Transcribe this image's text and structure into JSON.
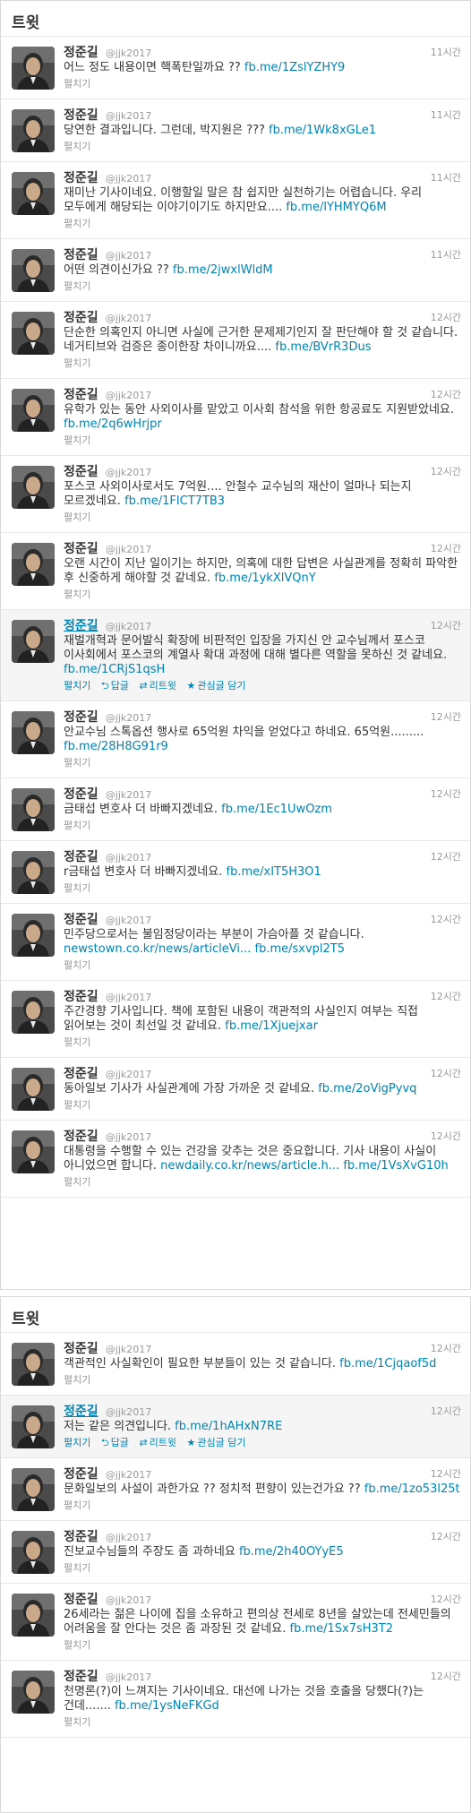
{
  "panels": [
    {
      "title": "트윗",
      "tweets": [
        {
          "name": "정준길",
          "handle": "@jjk2017",
          "time": "11시간",
          "text": "어느 정도 내용이면 핵폭탄일까요 ?? ",
          "link": "fb.me/1ZslYZHY9",
          "expand": "펼치기"
        },
        {
          "name": "정준길",
          "handle": "@jjk2017",
          "time": "11시간",
          "text": "당연한 결과입니다. 그런데, 박지원은 ??? ",
          "link": "fb.me/1Wk8xGLe1",
          "expand": "펼치기"
        },
        {
          "name": "정준길",
          "handle": "@jjk2017",
          "time": "11시간",
          "text": "재미난 기사이네요. 이행할일 말은 참 쉽지만 실천하기는 어렵습니다. 우리 모두에게 해당되는 이야기이기도 하지만요.... ",
          "link": "fb.me/lYHMYQ6M",
          "expand": "펼치기"
        },
        {
          "name": "정준길",
          "handle": "@jjk2017",
          "time": "11시간",
          "text": "어떤 의견이신가요 ?? ",
          "link": "fb.me/2jwxlWldM",
          "expand": "펼치기"
        },
        {
          "name": "정준길",
          "handle": "@jjk2017",
          "time": "12시간",
          "text": "단순한 의혹인지 아니면 사실에 근거한 문제제기인지 잘 판단해야 할 것 같습니다. 네거티브와 검증은 종이한장 차이니까요.... ",
          "link": "fb.me/BVrR3Dus",
          "expand": "펼치기"
        },
        {
          "name": "정준길",
          "handle": "@jjk2017",
          "time": "12시간",
          "text": "유학가 있는 동안 사외이사를 맡았고 이사회 참석을 위한 항공료도 지원받았네요. ",
          "link": "fb.me/2q6wHrjpr",
          "expand": "펼치기"
        },
        {
          "name": "정준길",
          "handle": "@jjk2017",
          "time": "12시간",
          "text": "포스코 사외이사로서도 7억원.... 안철수 교수님의 재산이 얼마나 되는지 모르겠네요. ",
          "link": "fb.me/1FICT7TB3",
          "expand": "펼치기"
        },
        {
          "name": "정준길",
          "handle": "@jjk2017",
          "time": "12시간",
          "text": "오랜 시간이 지난 일이기는 하지만, 의혹에 대한 답변은 사실관계를 정확히 파악한 후 신중하게 해야할 것 같네요. ",
          "link": "fb.me/1ykXlVQnY",
          "expand": "펼치기"
        },
        {
          "name": "정준길",
          "handle": "@jjk2017",
          "time": "12시간",
          "text": "재벌개혁과 문어발식 확장에 비판적인 입장을 가지신 안 교수님께서 포스코 이사회에서 포스코의 계열사 확대 과정에 대해 별다른 역할을 못하신 것 같네요. ",
          "link": "fb.me/1CRjS1qsH",
          "expand": "펼치기",
          "highlight": true,
          "actions": {
            "reply": "답글",
            "retweet": "리트윗",
            "favorite": "관심글 담기"
          }
        },
        {
          "name": "정준길",
          "handle": "@jjk2017",
          "time": "12시간",
          "text": "안교수님 스톡옵션 행사로 65억원 차익을 얻었다고 하네요. 65억원......... ",
          "link": "fb.me/28H8G91r9",
          "expand": "펼치기"
        },
        {
          "name": "정준길",
          "handle": "@jjk2017",
          "time": "12시간",
          "text": "금태섭 변호사 더 바빠지겠네요. ",
          "link": "fb.me/1Ec1UwOzm",
          "expand": "펼치기"
        },
        {
          "name": "정준길",
          "handle": "@jjk2017",
          "time": "12시간",
          "text": "r금태섭 변호사 더 바빠지겠네요. ",
          "link": "fb.me/xIT5H3O1",
          "expand": "펼치기"
        },
        {
          "name": "정준길",
          "handle": "@jjk2017",
          "time": "12시간",
          "text": "민주당으로서는 불임정당이라는 부분이 가슴아플 것 같습니다. ",
          "link": "newstown.co.kr/news/articleVi... fb.me/sxvpl2T5",
          "expand": "펼치기"
        },
        {
          "name": "정준길",
          "handle": "@jjk2017",
          "time": "12시간",
          "text": "주간경향 기사입니다. 책에 포함된 내용이 객관적의 사실인지 여부는 직접 읽어보는 것이 최선일 것 같네요. ",
          "link": "fb.me/1Xjuejxar",
          "expand": "펼치기"
        },
        {
          "name": "정준길",
          "handle": "@jjk2017",
          "time": "12시간",
          "text": "동아일보 기사가 사실관계에 가장 가까운 것 같네요. ",
          "link": "fb.me/2oVigPyvq",
          "expand": "펼치기"
        },
        {
          "name": "정준길",
          "handle": "@jjk2017",
          "time": "12시간",
          "text": "대통령을 수행할 수 있는 건강을 갖추는 것은 중요합니다. 기사 내용이 사실이 아니었으면 합니다. ",
          "link": "newdaily.co.kr/news/article.h... fb.me/1VsXvG10h",
          "expand": "펼치기"
        }
      ]
    },
    {
      "title": "트윗",
      "tweets": [
        {
          "name": "정준길",
          "handle": "@jjk2017",
          "time": "12시간",
          "text": "객관적인 사실확인이 필요한 부분들이 있는 것 같습니다. ",
          "link": "fb.me/1Cjqaof5d",
          "expand": "펼치기"
        },
        {
          "name": "정준길",
          "handle": "@jjk2017",
          "time": "12시간",
          "text": "저는 같은 의견입니다. ",
          "link": "fb.me/1hAHxN7RE",
          "expand": "펼치기",
          "highlight": true,
          "actions": {
            "reply": "답글",
            "retweet": "리트윗",
            "favorite": "관심글 담기"
          }
        },
        {
          "name": "정준길",
          "handle": "@jjk2017",
          "time": "12시간",
          "text": "문화일보의 사설이 과한가요 ?? 정치적 편향이 있는건가요 ?? ",
          "link": "fb.me/1zo53l25t",
          "expand": "펼치기"
        },
        {
          "name": "정준길",
          "handle": "@jjk2017",
          "time": "12시간",
          "text": "진보교수님들의 주장도 좀 과하네요 ",
          "link": "fb.me/2h40OYyE5",
          "expand": "펼치기"
        },
        {
          "name": "정준길",
          "handle": "@jjk2017",
          "time": "12시간",
          "text": "26세라는 젊은 나이에 집을 소유하고 편의상 전세로 8년을 살았는데 전세민들의 어려움을 잘 안다는 것은 좀 과장된 것 같네요. ",
          "link": "fb.me/1Sx7sH3T2",
          "expand": "펼치기"
        },
        {
          "name": "정준길",
          "handle": "@jjk2017",
          "time": "12시간",
          "text": "천명론(?)이 느껴지는 기사이네요. 대선에 나가는 것을 호출을 당했다(?)는 건데....... ",
          "link": "fb.me/1ysNeFKGd",
          "expand": "펼치기"
        }
      ]
    }
  ],
  "icons": {
    "reply": "reply-arrow-icon",
    "retweet": "retweet-icon",
    "favorite": "star-icon"
  }
}
